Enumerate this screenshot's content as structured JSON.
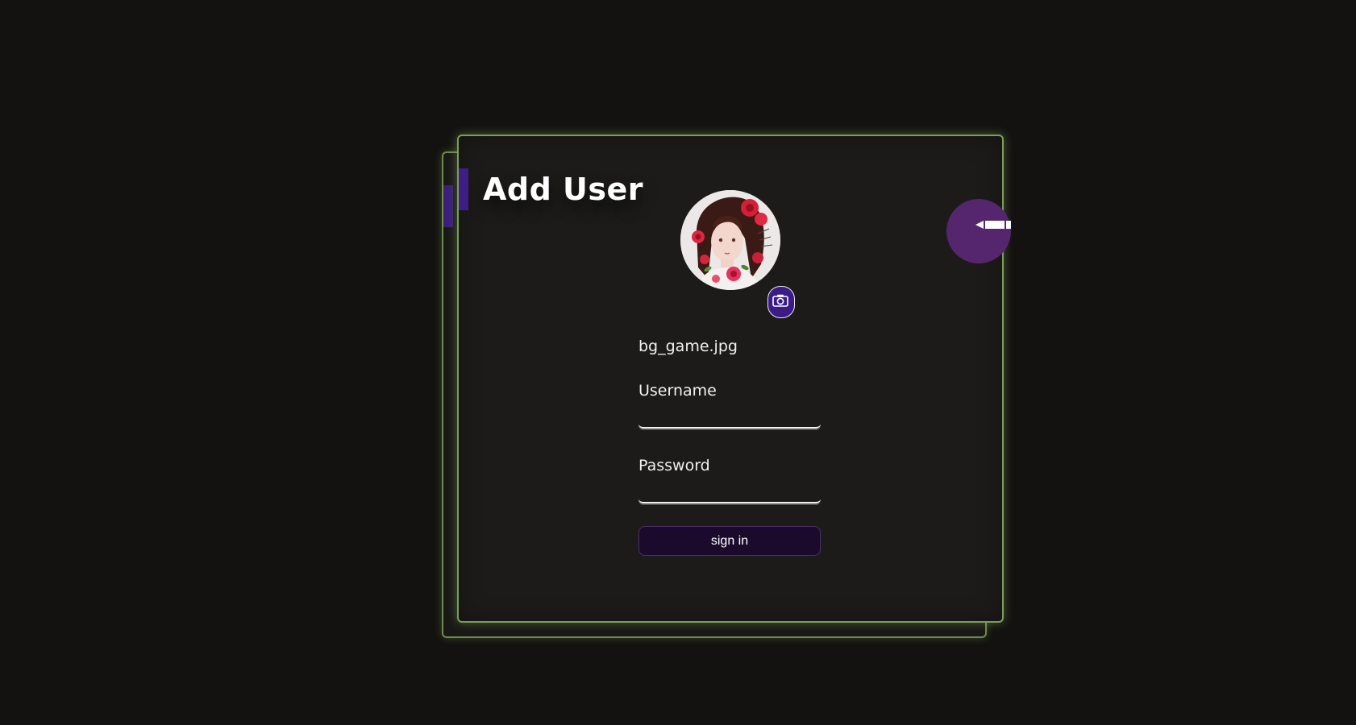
{
  "card": {
    "title": "Add User"
  },
  "profile": {
    "avatar_icon": "portrait-avatar",
    "upload_icon": "camera-icon",
    "filename": "bg_game.jpg"
  },
  "form": {
    "username_label": "Username",
    "username_value": "",
    "password_label": "Password",
    "password_value": "",
    "submit_label": "sign in"
  },
  "toolbar": {
    "edit_icon": "pen-icon"
  },
  "colors": {
    "background": "#131211",
    "card_border": "#7e9c58",
    "accent_purple": "#3d1e86",
    "edit_button": "#55266e",
    "signin_bg": "#1b0a2c"
  }
}
